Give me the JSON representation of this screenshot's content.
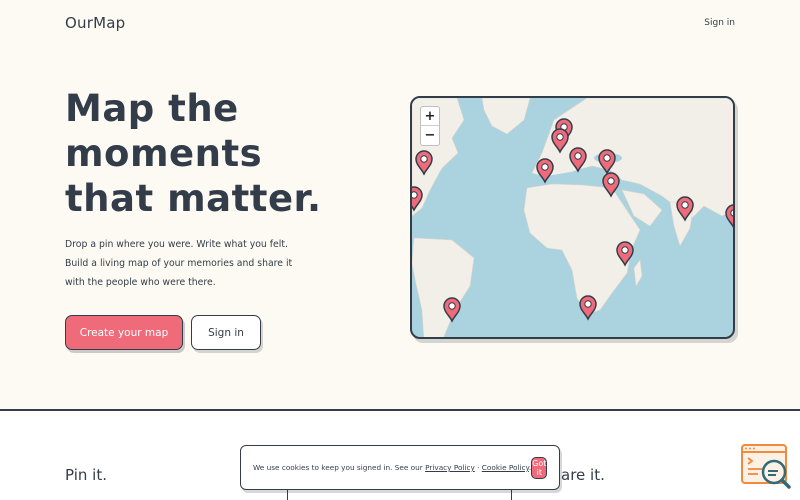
{
  "app": {
    "logo": "OurMap"
  },
  "nav": {
    "signin_label": "Sign in"
  },
  "hero": {
    "title_lines": [
      "Map the",
      "moments",
      "that matter."
    ],
    "description_lines": [
      "Drop a pin where you were. Write what you felt.",
      "Build a living map of your memories and share it",
      "with the people who were there."
    ],
    "primary_cta": "Create your map",
    "secondary_cta": "Sign in"
  },
  "map": {
    "zoom_in": "+",
    "zoom_out": "−",
    "icons": {
      "pin": "map-pin-icon"
    }
  },
  "features": {
    "items": [
      {
        "title": "Pin it."
      },
      {
        "title": "are it."
      }
    ]
  },
  "cookie": {
    "text": "We use cookies to keep you signed in. See our",
    "privacy_link": "Privacy Policy",
    "separator": "·",
    "cookie_link": "Cookie Policy",
    "end": ".",
    "accept_label": "Got it"
  },
  "colors": {
    "accent": "#ef6b7a",
    "ink": "#333d4a",
    "background": "#fdfaf3",
    "water": "#aad3df",
    "land": "#f2efe9"
  }
}
